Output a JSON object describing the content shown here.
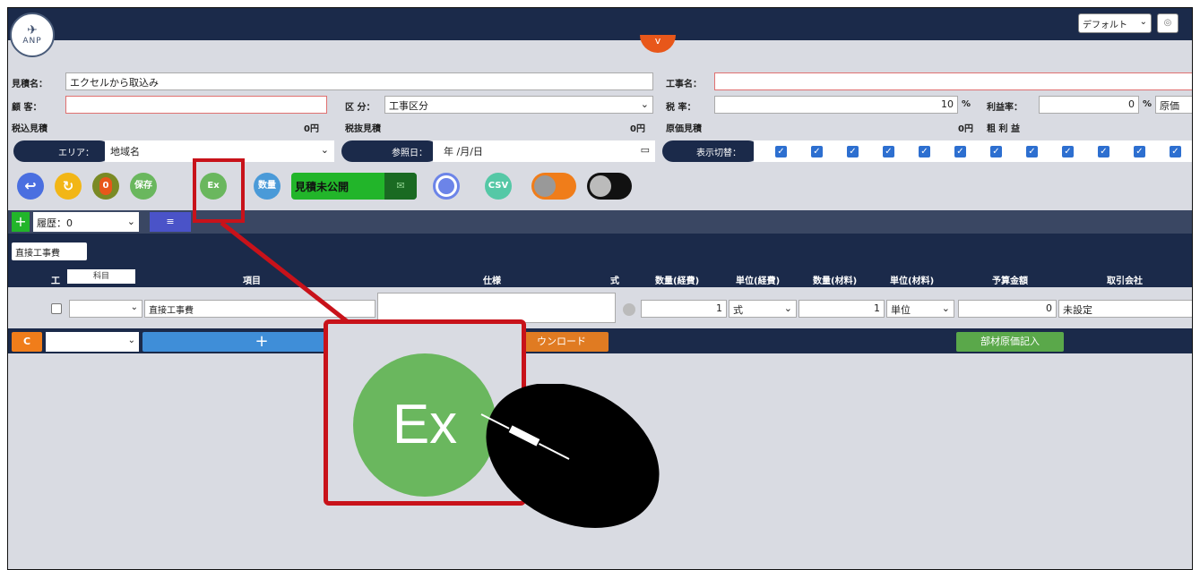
{
  "header": {
    "logo_text": "ANP",
    "preset_select": "デフォルト",
    "collapse_glyph": "v"
  },
  "form": {
    "estimate_name_label": "見積名：",
    "estimate_name_value": "エクセルから取込み",
    "work_name_label": "工事名：",
    "customer_label": "顧 客：",
    "division_label": "区 分：",
    "division_value": "工事区分",
    "tax_rate_label": "税 率：",
    "tax_rate_value": "10",
    "percent": "%",
    "profit_rate_label": "利益率：",
    "profit_rate_value": "0",
    "cost_label_partial": "原価",
    "tax_incl_label": "税込見積",
    "tax_incl_value": "0円",
    "tax_excl_label": "税抜見積",
    "tax_excl_value": "0円",
    "cost_estimate_label": "原価見積",
    "cost_estimate_value": "0円",
    "gross_profit_label": "粗 利 益"
  },
  "filters": {
    "area_label": "エリア：",
    "area_value": "地域名",
    "ref_date_label": "参照日：",
    "ref_date_value": "年 /月/日",
    "display_toggle_label": "表示切替："
  },
  "toolbar": {
    "save_label": "保存",
    "excel_label": "Ex",
    "unknown_label": "数量",
    "status_select": "見積未公開",
    "csv_label": "CSV"
  },
  "history": {
    "history_select": "履歴：0",
    "menu_glyph": "≡"
  },
  "section_tab": "直接工事費",
  "table": {
    "headers": [
      "工",
      "科目",
      "項目",
      "仕様",
      "式",
      "数量(経費)",
      "単位(経費)",
      "数量(材料)",
      "単位(材料)",
      "予算金額",
      "取引会社"
    ],
    "row": {
      "item": "直接工事費",
      "qty1": "1",
      "unit1": "式",
      "qty2": "1",
      "unit2": "単位",
      "budget": "0",
      "company": "未設定"
    }
  },
  "bottom_bar": {
    "c_label": "C",
    "add_glyph": "+",
    "download_label": "ウンロード",
    "material_cost_label": "部材原価記入"
  },
  "callout": {
    "big_label": "Ex"
  },
  "colors": {
    "navy": "#1b2a4a",
    "orange": "#e8571a",
    "green": "#6ab75e",
    "highlight_red": "#c8121a",
    "blue": "#2d6fd0"
  }
}
